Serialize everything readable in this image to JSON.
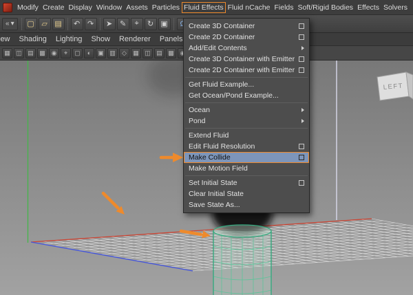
{
  "colors": {
    "annotation_orange": "#ee8a2c",
    "menu_highlight_blue": "#7d95ba",
    "axis_green": "#44b649",
    "plane_edge_red": "#cc4433",
    "plane_edge_blue": "#4455dd",
    "cylinder_teal": "#35aa7f"
  },
  "menubar": {
    "items": [
      "Modify",
      "Create",
      "Display",
      "Window",
      "Assets",
      "Particles",
      "Fluid Effects",
      "Fluid nCache",
      "Fields",
      "Soft/Rigid Bodies",
      "Effects",
      "Solvers"
    ],
    "highlighted_item": "Fluid Effects"
  },
  "status_line": {
    "icons": [
      "«",
      "▾",
      "▢",
      "▱",
      "▤",
      "↶",
      "↷",
      "➤",
      "✎",
      "⌖",
      "↻",
      "▣",
      "Ω",
      "Ω",
      "Ω",
      "Ω",
      "▦",
      "⚙",
      "◉",
      "◐",
      "●"
    ]
  },
  "panel_bar": {
    "items": [
      "iew",
      "Shading",
      "Lighting",
      "Show",
      "Renderer",
      "Panels"
    ]
  },
  "viewport_bar": {
    "icons": [
      "▦",
      "◫",
      "▤",
      "▩",
      "◉",
      "⌖",
      "▢",
      "◐",
      "▣",
      "▥",
      "◇",
      "▦",
      "◫",
      "▤",
      "▩",
      "◉",
      "⌖",
      "▢",
      "◐",
      "▣",
      "▥",
      "◇",
      "●",
      "◍"
    ]
  },
  "fluid_menu": {
    "opened_from": "Fluid Effects",
    "items": [
      {
        "label": "Create 3D Container",
        "option_box": true
      },
      {
        "label": "Create 2D Container",
        "option_box": true
      },
      {
        "label": "Add/Edit Contents",
        "submenu": true
      },
      {
        "label": "Create 3D Container with Emitter",
        "option_box": true
      },
      {
        "label": "Create 2D Container with Emitter",
        "option_box": true
      },
      {
        "label": "Get Fluid Example..."
      },
      {
        "label": "Get Ocean/Pond Example..."
      },
      {
        "label": "Ocean",
        "submenu": true
      },
      {
        "label": "Pond",
        "submenu": true
      },
      {
        "label": "Extend Fluid"
      },
      {
        "label": "Edit Fluid Resolution",
        "option_box": true
      },
      {
        "label": "Make Collide",
        "option_box": true,
        "highlighted": true
      },
      {
        "label": "Make Motion Field"
      },
      {
        "label": "Set Initial State",
        "option_box": true
      },
      {
        "label": "Clear Initial State"
      },
      {
        "label": "Save State As..."
      }
    ]
  },
  "viewport": {
    "view_cube_label": "LEFT"
  }
}
